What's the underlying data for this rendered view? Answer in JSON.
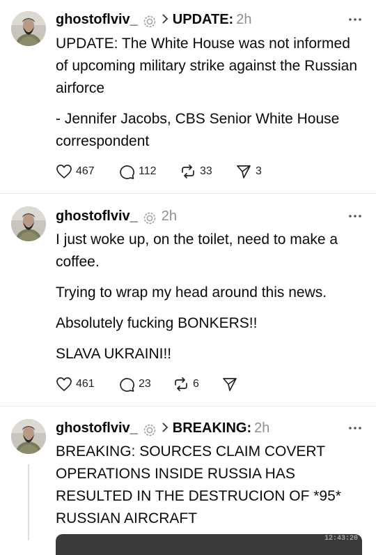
{
  "posts": [
    {
      "username": "ghostoflviv_",
      "topic": "UPDATE:",
      "time": "2h",
      "paragraphs": [
        "UPDATE: The White House was not informed of upcoming military strike against the Russian airforce",
        "- Jennifer Jacobs, CBS Senior White House correspondent"
      ],
      "likes": "467",
      "replies": "112",
      "reposts": "33",
      "shares": "3"
    },
    {
      "username": "ghostoflviv_",
      "topic": "",
      "time": "2h",
      "paragraphs": [
        "I just woke up, on the toilet, need to make a coffee.",
        "Trying to wrap my head around this news.",
        "Absolutely fucking BONKERS!!",
        "SLAVA UKRAINI!!"
      ],
      "likes": "461",
      "replies": "23",
      "reposts": "6",
      "shares": ""
    },
    {
      "username": "ghostoflviv_",
      "topic": "BREAKING:",
      "time": "2h",
      "paragraphs": [
        "BREAKING: SOURCES CLAIM COVERT OPERATIONS INSIDE RUSSIA HAS RESULTED IN THE DESTRUCION OF *95* RUSSIAN AIRCRAFT"
      ],
      "media_stamp": "12:43:20"
    }
  ],
  "icons": {
    "verified": "verified-badge-icon",
    "more": "more-horizontal-icon",
    "like": "heart-icon",
    "reply": "comment-icon",
    "repost": "repost-icon",
    "share": "send-icon"
  },
  "colors": {
    "text": "#0a0a0a",
    "muted": "#8e8e8e",
    "divider": "#e6e6e6"
  }
}
